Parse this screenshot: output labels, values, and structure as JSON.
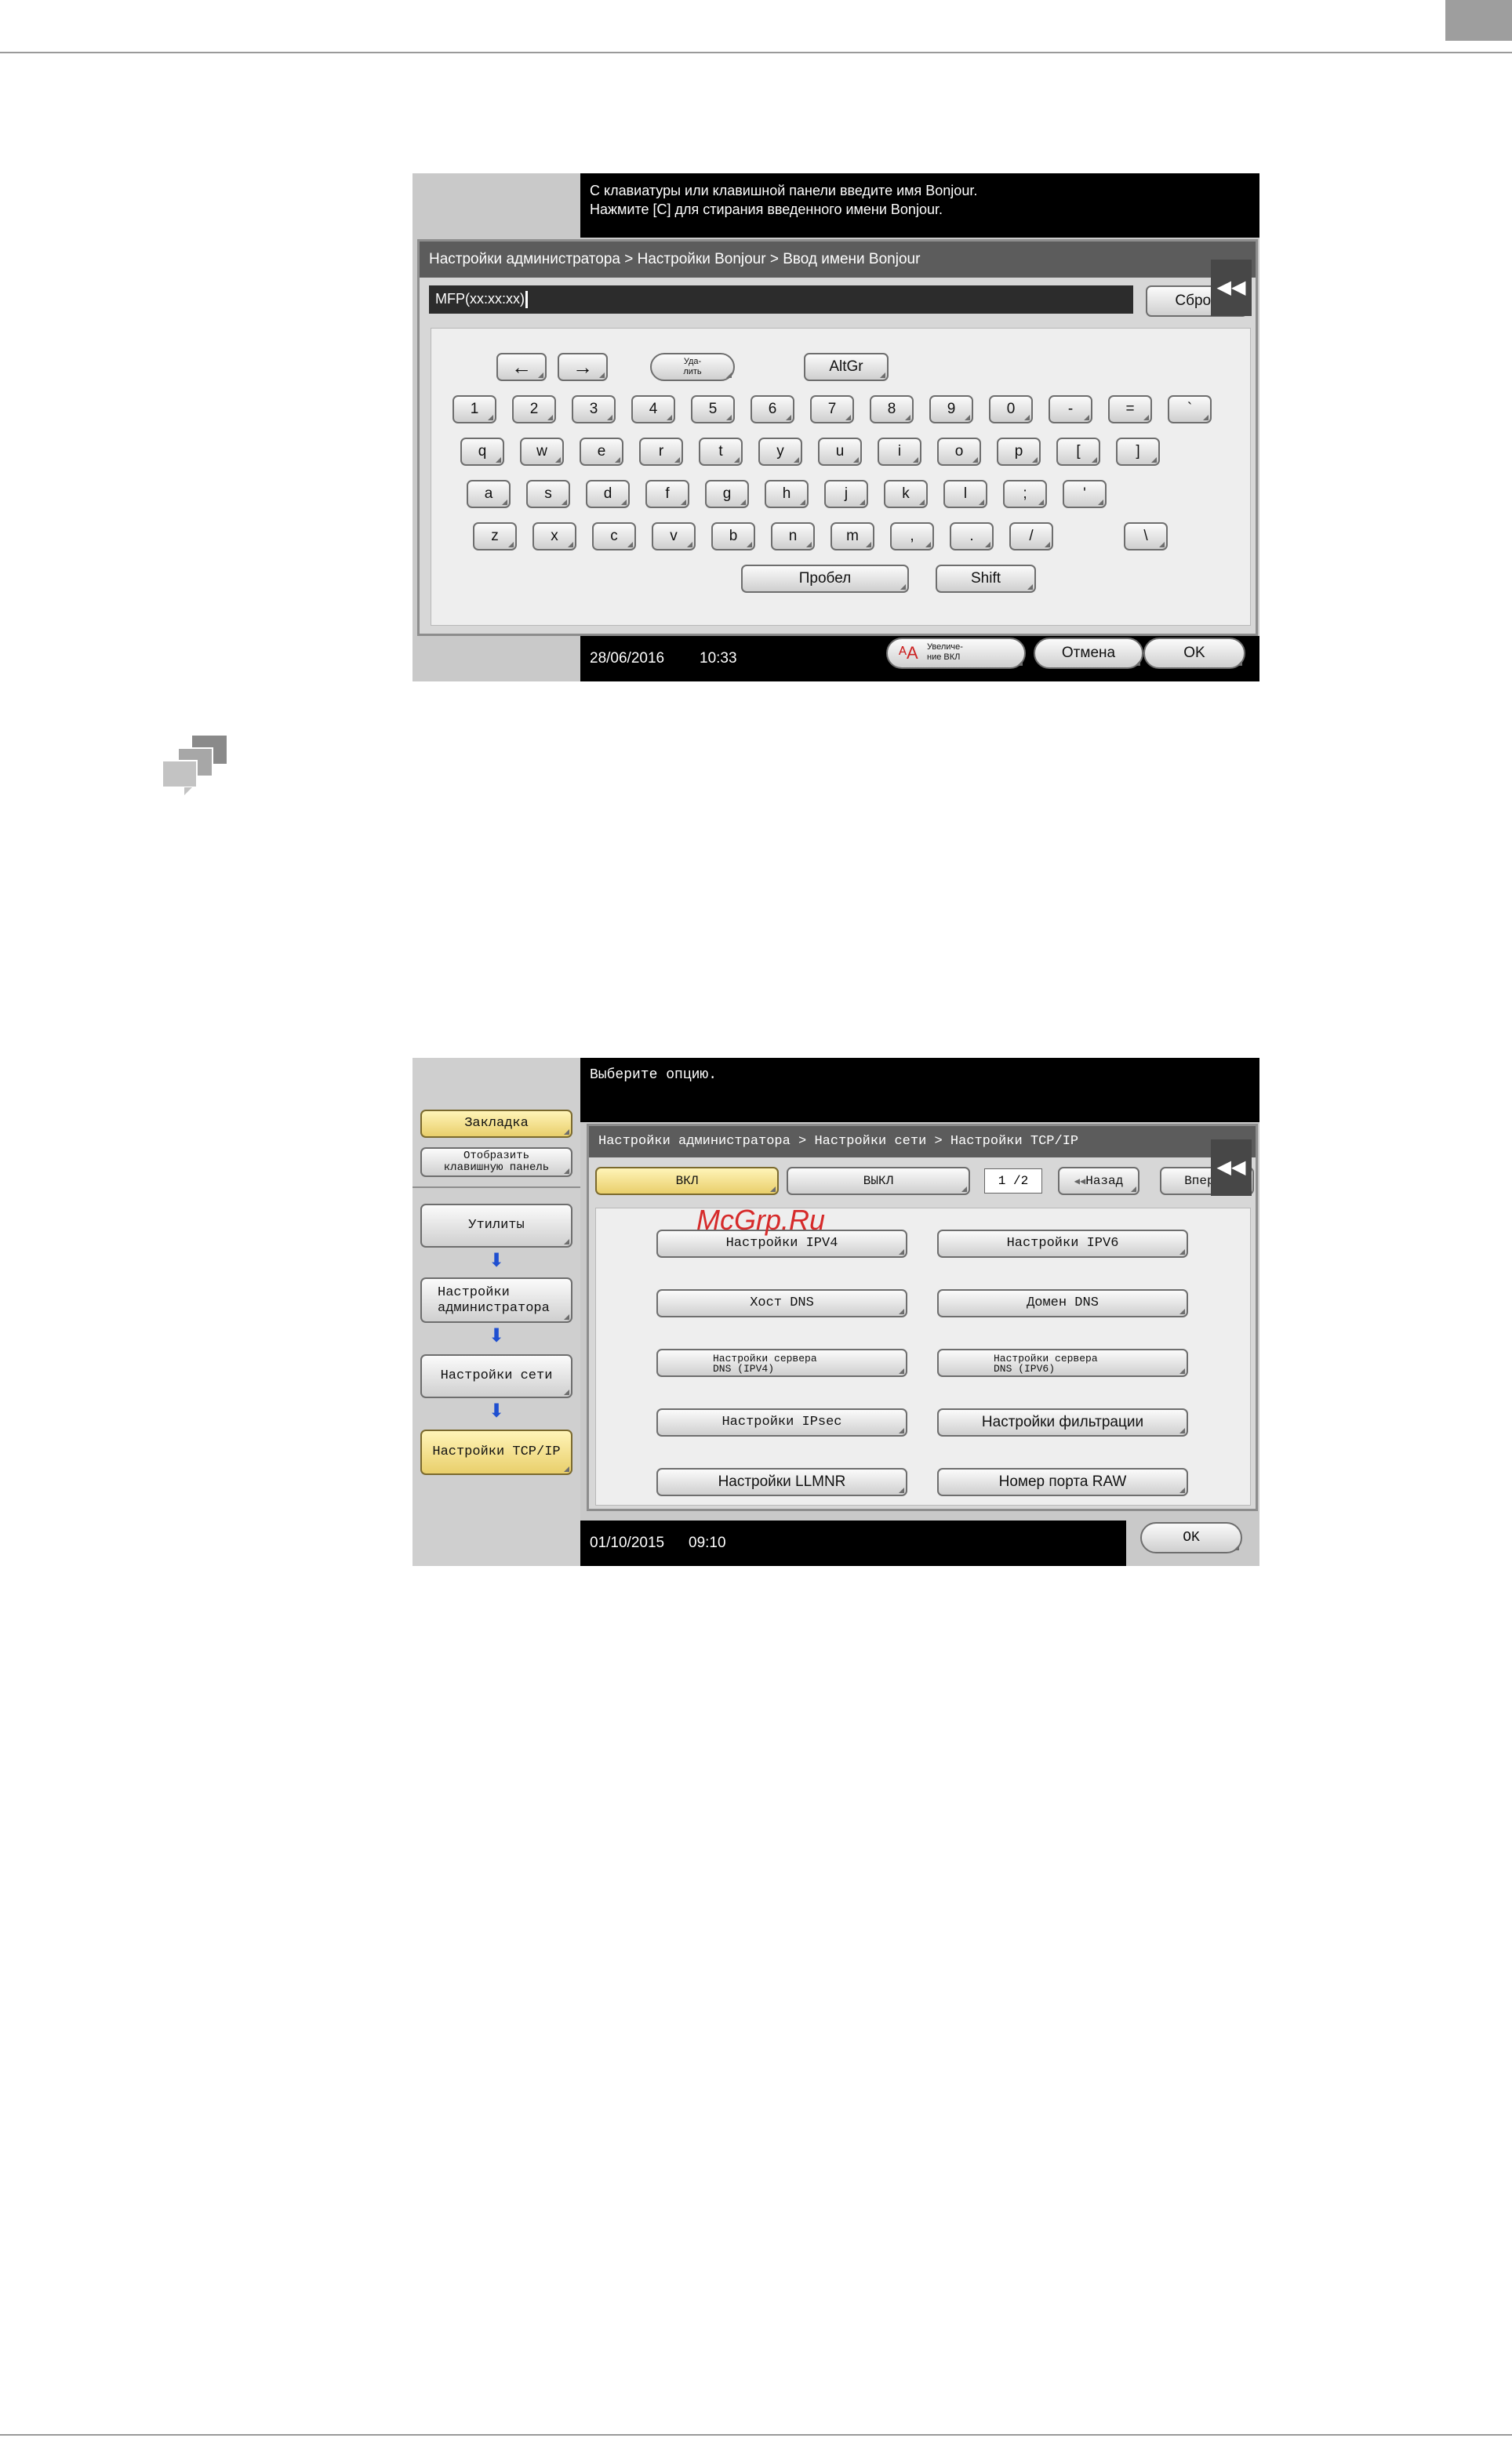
{
  "panel1": {
    "message_line1": "С клавиатуры или клавишной панели введите имя Bonjour.",
    "message_line2": "Нажмите [C] для стирания введенного имени Bonjour.",
    "breadcrumb": "Настройки администратора > Настройки Bonjour > Ввод имени Bonjour",
    "input_value": "MFP(xx:xx:xx)",
    "reset_label": "Сброс",
    "collapse_icon": "double-left-arrow-icon",
    "keys": {
      "left_arrow": "←",
      "right_arrow": "→",
      "delete_label_1": "Уда-",
      "delete_label_2": "лить",
      "altgr": "AltGr",
      "row1": [
        "1",
        "2",
        "3",
        "4",
        "5",
        "6",
        "7",
        "8",
        "9",
        "0",
        "-",
        "=",
        "`"
      ],
      "row2": [
        "q",
        "w",
        "e",
        "r",
        "t",
        "y",
        "u",
        "i",
        "o",
        "p",
        "[",
        "]"
      ],
      "row3": [
        "a",
        "s",
        "d",
        "f",
        "g",
        "h",
        "j",
        "k",
        "l",
        ";",
        "'"
      ],
      "row4": [
        "z",
        "x",
        "c",
        "v",
        "b",
        "n",
        "m",
        ",",
        ".",
        "/",
        "\\"
      ],
      "space": "Пробел",
      "shift": "Shift"
    },
    "date": "28/06/2016",
    "time": "10:33",
    "zoom_label_1": "Увеличе-",
    "zoom_label_2": "ние ВКЛ",
    "cancel_label": "Отмена",
    "ok_label": "OK"
  },
  "panel2": {
    "message": "Выберите опцию.",
    "bookmark_label": "Закладка",
    "show_keypad_line1": "Отобразить",
    "show_keypad_line2": "клавишную панель",
    "nav": {
      "utilities": "Утилиты",
      "admin_line1": "Настройки",
      "admin_line2": "администратора",
      "network": "Настройки сети",
      "tcpip": "Настройки TCP/IP"
    },
    "breadcrumb": "Настройки администратора > Настройки сети > Настройки TCP/IP",
    "on_label": "ВКЛ",
    "off_label": "ВЫКЛ",
    "page": "1 /2",
    "back_label": "Назад",
    "forward_label": "Вперед",
    "options": [
      "Настройки IPV4",
      "Настройки IPV6",
      "Хост DNS",
      "Домен DNS",
      "Настройки сервера DNS (IPV4)",
      "Настройки сервера DNS (IPV6)",
      "Настройки IPsec",
      "Настройки фильтрации",
      "Настройки LLMNR",
      "Номер порта RAW"
    ],
    "date": "01/10/2015",
    "time": "09:10",
    "ok_label": "OK"
  },
  "watermark": "McGrp.Ru"
}
